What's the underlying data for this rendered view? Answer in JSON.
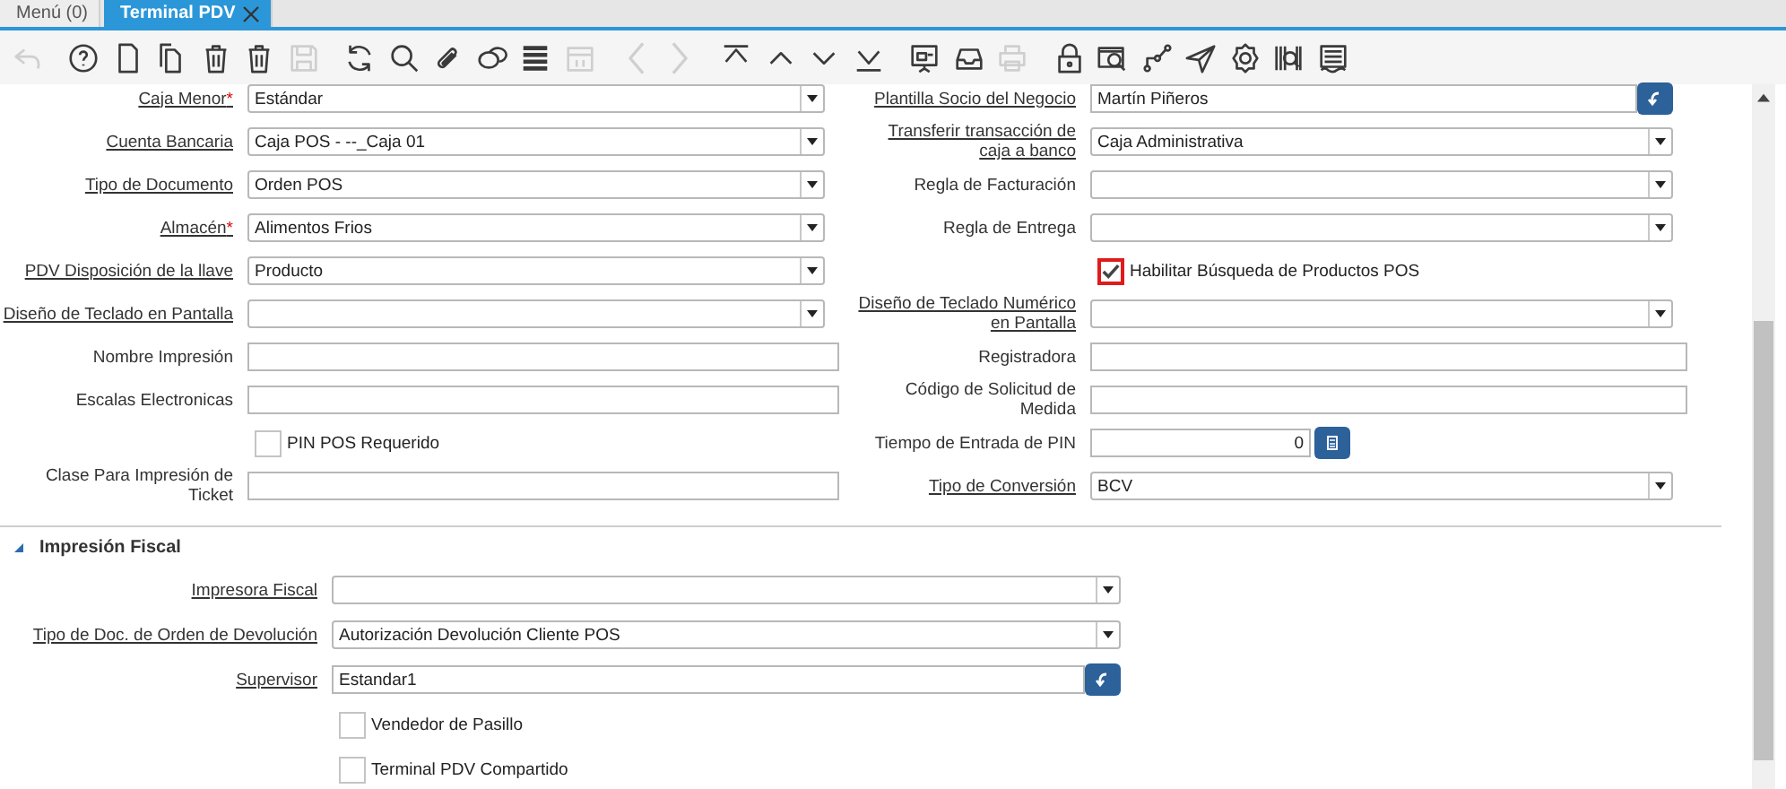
{
  "tabs": [
    {
      "label": "Menú (0)",
      "selected": false,
      "closable": false
    },
    {
      "label": "Terminal PDV",
      "selected": true,
      "closable": true
    }
  ],
  "toolbar": [
    {
      "buttons": [
        {
          "kind": "undo",
          "disabled": true
        }
      ]
    },
    {
      "buttons": [
        {
          "kind": "help",
          "disabled": false
        },
        {
          "kind": "new",
          "disabled": false
        },
        {
          "kind": "copy",
          "disabled": false
        },
        {
          "kind": "delete",
          "disabled": false
        },
        {
          "kind": "delete-selection",
          "disabled": false
        },
        {
          "kind": "save",
          "disabled": true
        }
      ]
    },
    {
      "buttons": [
        {
          "kind": "refresh",
          "disabled": false
        },
        {
          "kind": "find",
          "disabled": false
        },
        {
          "kind": "attach",
          "disabled": false
        },
        {
          "kind": "chat",
          "disabled": false
        },
        {
          "kind": "grid",
          "disabled": false
        },
        {
          "kind": "calendar",
          "disabled": true
        }
      ]
    },
    {
      "buttons": [
        {
          "kind": "previous",
          "disabled": true
        },
        {
          "kind": "next",
          "disabled": true
        }
      ]
    },
    {
      "buttons": [
        {
          "kind": "first",
          "disabled": false
        },
        {
          "kind": "up",
          "disabled": false
        },
        {
          "kind": "down",
          "disabled": false
        },
        {
          "kind": "last",
          "disabled": false
        }
      ]
    },
    {
      "buttons": [
        {
          "kind": "report",
          "disabled": false
        },
        {
          "kind": "archive",
          "disabled": false
        },
        {
          "kind": "print",
          "disabled": true
        }
      ]
    },
    {
      "buttons": [
        {
          "kind": "lock",
          "disabled": false
        },
        {
          "kind": "zoom",
          "disabled": false
        },
        {
          "kind": "workflow",
          "disabled": false
        },
        {
          "kind": "send",
          "disabled": false
        },
        {
          "kind": "settings",
          "disabled": false
        },
        {
          "kind": "barcode",
          "disabled": false
        },
        {
          "kind": "document",
          "disabled": false
        }
      ]
    }
  ],
  "form": {
    "rows": [
      {
        "left": {
          "kind": "combo",
          "label": "Caja Menor",
          "link": true,
          "required_mark": "*",
          "value": "Estándar"
        },
        "right": {
          "kind": "search",
          "label": "Plantilla Socio del Negocio",
          "link": true,
          "value": "Martín Piñeros"
        }
      },
      {
        "left": {
          "kind": "combo",
          "label": "Cuenta Bancaria",
          "link": true,
          "value": "Caja POS - --_Caja 01"
        },
        "right": {
          "kind": "combo",
          "label": "Transferir transacción de caja a banco",
          "link": true,
          "value": "Caja Administrativa"
        }
      },
      {
        "left": {
          "kind": "combo",
          "label": "Tipo de Documento",
          "link": true,
          "value": "Orden POS"
        },
        "right": {
          "kind": "combo",
          "label": "Regla de Facturación",
          "link": false
        }
      },
      {
        "left": {
          "kind": "combo",
          "label": "Almacén",
          "link": true,
          "required_mark": "*",
          "value": "Alimentos Frios"
        },
        "right": {
          "kind": "combo",
          "label": "Regla de Entrega",
          "link": false
        }
      },
      {
        "left": {
          "kind": "combo",
          "label": "PDV Disposición de la llave",
          "link": true,
          "value": "Producto"
        },
        "right": {
          "kind": "checkbox",
          "label": "Habilitar Búsqueda de Productos POS",
          "checked": true,
          "focused": true
        }
      },
      {
        "left": {
          "kind": "combo",
          "label": "Diseño de Teclado en Pantalla",
          "link": true
        },
        "right": {
          "kind": "combo",
          "label": "Diseño de Teclado Numérico en Pantalla",
          "link": true
        }
      },
      {
        "left": {
          "kind": "text",
          "label": "Nombre Impresión",
          "link": false
        },
        "right": {
          "kind": "text",
          "label": "Registradora",
          "link": false
        }
      },
      {
        "left": {
          "kind": "text",
          "label": "Escalas Electronicas",
          "link": false
        },
        "right": {
          "kind": "text",
          "label": "Código de Solicitud de Medida",
          "link": false
        }
      },
      {
        "left": {
          "kind": "checkbox",
          "label": "PIN POS Requerido",
          "checked": false,
          "focused": false
        },
        "right": {
          "kind": "number",
          "label": "Tiempo de Entrada de PIN",
          "link": false,
          "value": "0"
        }
      },
      {
        "left": {
          "kind": "text",
          "label": "Clase Para Impresión de Ticket",
          "link": false
        },
        "right": {
          "kind": "combo",
          "label": "Tipo de Conversión",
          "link": true,
          "value": "BCV"
        }
      }
    ]
  },
  "sections": [
    {
      "title": "Impresión Fiscal",
      "expanded": true,
      "fields": [
        {
          "kind": "combo",
          "label": "Impresora Fiscal",
          "link": true
        },
        {
          "kind": "combo",
          "label": "Tipo de Doc. de Orden de Devolución",
          "link": true,
          "value": "Autorización Devolución Cliente POS"
        },
        {
          "kind": "search",
          "label": "Supervisor",
          "link": true,
          "value": "Estandar1"
        },
        {
          "kind": "checkbox",
          "label": "Vendedor de Pasillo",
          "checked": false,
          "focused": false
        },
        {
          "kind": "checkbox",
          "label": "Terminal PDV Compartido",
          "checked": false,
          "focused": false
        }
      ]
    }
  ]
}
